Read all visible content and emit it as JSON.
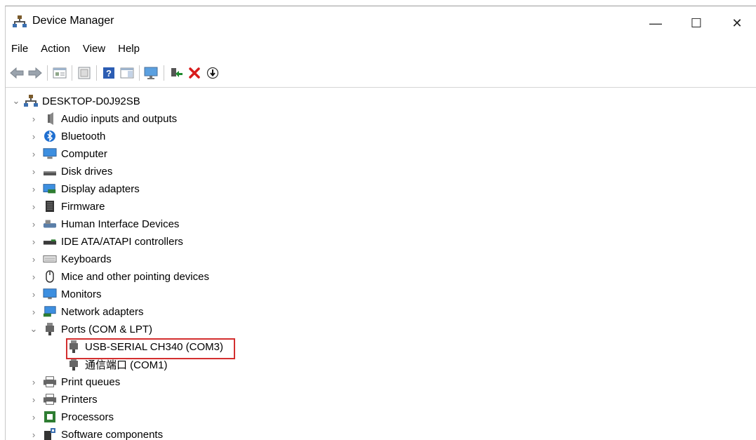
{
  "window": {
    "title": "Device Manager",
    "controls": {
      "minimize": "—",
      "maximize": "☐",
      "close": "✕"
    }
  },
  "menu": [
    "File",
    "Action",
    "View",
    "Help"
  ],
  "toolbar": {
    "buttons": [
      "back-arrow-icon",
      "forward-arrow-icon",
      "properties-icon",
      "show-hidden-icon",
      "help-icon",
      "action-pane-icon",
      "monitor-icon",
      "add-driver-icon",
      "uninstall-icon",
      "update-driver-icon"
    ],
    "uninstall_color": "#d81c1c",
    "add_driver_color": "#1e8b2f"
  },
  "tree": {
    "root": "DESKTOP-D0J92SB",
    "categories": [
      "Audio inputs and outputs",
      "Bluetooth",
      "Computer",
      "Disk drives",
      "Display adapters",
      "Firmware",
      "Human Interface Devices",
      "IDE ATA/ATAPI controllers",
      "Keyboards",
      "Mice and other pointing devices",
      "Monitors",
      "Network adapters",
      "Ports (COM & LPT)",
      "Print queues",
      "Printers",
      "Processors",
      "Software components"
    ],
    "ports_children": [
      "USB-SERIAL CH340 (COM3)",
      "通信端口 (COM1)"
    ],
    "highlight_color": "#d32f2f"
  }
}
